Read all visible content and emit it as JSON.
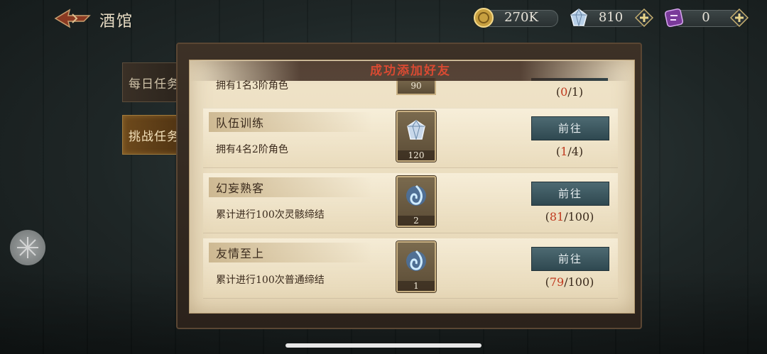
{
  "header": {
    "title": "酒馆",
    "gold": "270K",
    "diamond": "810",
    "ticket": "0"
  },
  "tabs": [
    {
      "label": "每日任务"
    },
    {
      "label": "挑战任务"
    }
  ],
  "toast": "成功添加好友",
  "partial_task": {
    "desc": "拥有1名3阶角色",
    "reward_qty": "90",
    "progress_current": "0",
    "progress_total": "/1)"
  },
  "tasks": [
    {
      "name": "队伍训练",
      "desc": "拥有4名2阶角色",
      "reward_qty": "120",
      "reward_icon": "diamond-icon",
      "button": "前往",
      "progress_current": "1",
      "progress_total": "/4)"
    },
    {
      "name": "幻妄熟客",
      "desc": "累计进行100次灵骸缔结",
      "reward_qty": "2",
      "reward_icon": "blue-flame-icon",
      "button": "前往",
      "progress_current": "81",
      "progress_total": "/100)"
    },
    {
      "name": "友情至上",
      "desc": "累计进行100次普通缔结",
      "reward_qty": "1",
      "reward_icon": "blue-flame-icon",
      "button": "前往",
      "progress_current": "79",
      "progress_total": "/100)"
    }
  ],
  "progress_open": "(",
  "colors": {
    "accent_red": "#c0391e",
    "button_teal": "#3d5a62",
    "paper": "#e9dcbf"
  }
}
